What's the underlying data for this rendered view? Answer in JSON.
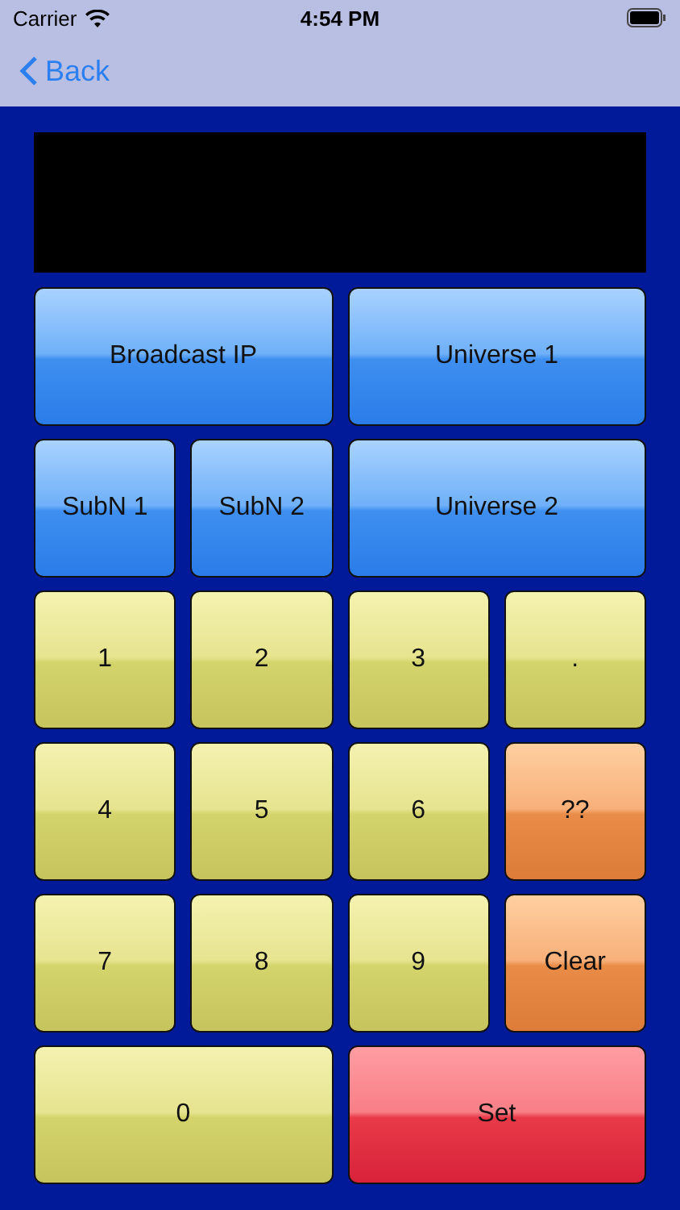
{
  "status_bar": {
    "carrier": "Carrier",
    "time": "4:54 PM"
  },
  "nav_bar": {
    "back": "Back"
  },
  "keys": [
    {
      "label": "Broadcast IP",
      "kind": "blue",
      "wide": true
    },
    {
      "label": "Universe 1",
      "kind": "blue",
      "wide": true
    },
    {
      "label": "SubN 1",
      "kind": "blue",
      "wide": false
    },
    {
      "label": "SubN 2",
      "kind": "blue",
      "wide": false
    },
    {
      "label": "Universe 2",
      "kind": "blue",
      "wide": true
    },
    {
      "label": "1",
      "kind": "yellow",
      "wide": false
    },
    {
      "label": "2",
      "kind": "yellow",
      "wide": false
    },
    {
      "label": "3",
      "kind": "yellow",
      "wide": false
    },
    {
      "label": ".",
      "kind": "yellow",
      "wide": false
    },
    {
      "label": "4",
      "kind": "yellow",
      "wide": false
    },
    {
      "label": "5",
      "kind": "yellow",
      "wide": false
    },
    {
      "label": "6",
      "kind": "yellow",
      "wide": false
    },
    {
      "label": "??",
      "kind": "orange",
      "wide": false
    },
    {
      "label": "7",
      "kind": "yellow",
      "wide": false
    },
    {
      "label": "8",
      "kind": "yellow",
      "wide": false
    },
    {
      "label": "9",
      "kind": "yellow",
      "wide": false
    },
    {
      "label": "Clear",
      "kind": "orange",
      "wide": false
    },
    {
      "label": "0",
      "kind": "yellow",
      "wide": true
    },
    {
      "label": "Set",
      "kind": "red",
      "wide": true
    }
  ]
}
